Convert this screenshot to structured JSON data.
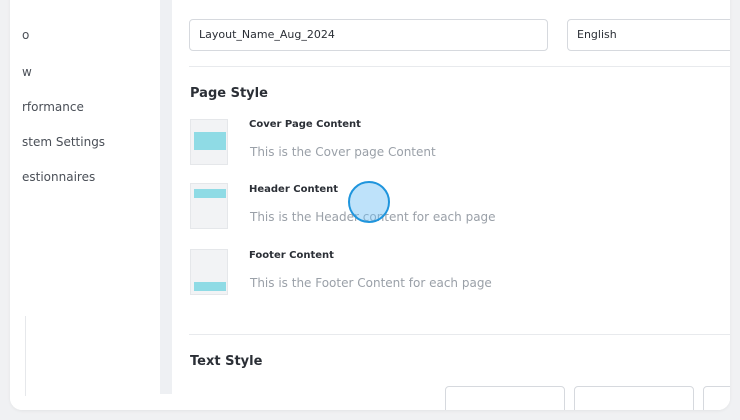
{
  "sidebar": {
    "items": [
      {
        "label": "o"
      },
      {
        "label": "w"
      },
      {
        "label": "rformance"
      },
      {
        "label": "stem Settings"
      },
      {
        "label": "estionnaires"
      }
    ]
  },
  "form": {
    "layout_name": "Layout_Name_Aug_2024",
    "language": "English"
  },
  "page_style": {
    "heading": "Page Style",
    "rows": [
      {
        "title": "Cover Page Content",
        "description": "This is the Cover page Content"
      },
      {
        "title": "Header Content",
        "description": "This is the Header content for each page"
      },
      {
        "title": "Footer Content",
        "description": "This is the Footer Content for each page"
      }
    ]
  },
  "text_style": {
    "heading": "Text Style"
  },
  "colors": {
    "thumb_bar": "#8fdbe5",
    "cursor": "#1f95dd"
  }
}
